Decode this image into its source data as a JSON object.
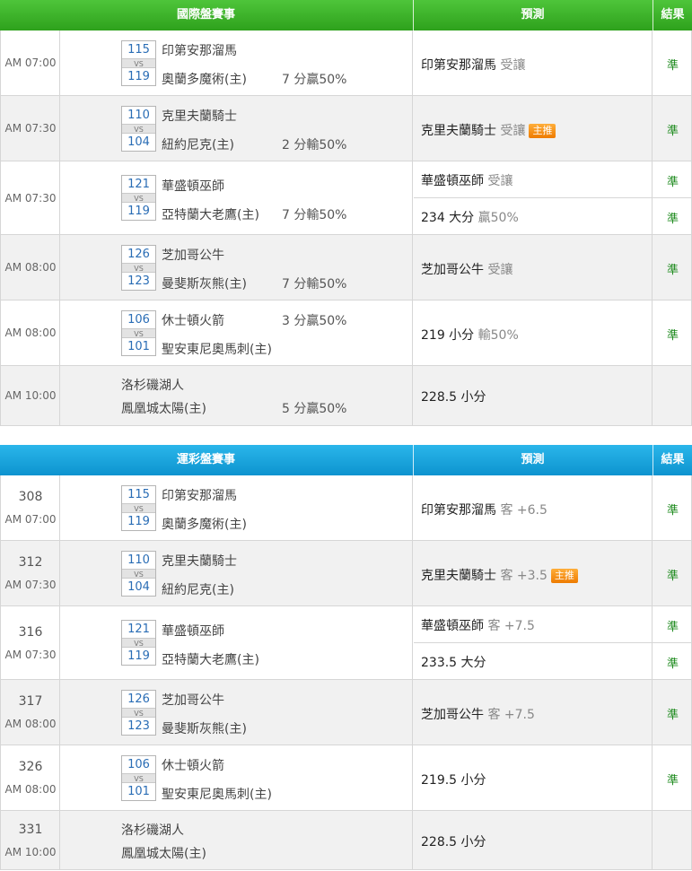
{
  "t1": {
    "header": {
      "game": "國際盤賽事",
      "pred": "預測",
      "result": "結果"
    },
    "r1": {
      "time": "AM 07:00",
      "rot_away": "115",
      "rot_home": "119",
      "vs": "VS",
      "away": "印第安那溜馬",
      "home": "奧蘭多魔術(主)",
      "hcp": "7 分贏50%",
      "pred_team": "印第安那溜馬",
      "pred_type": "受讓",
      "result": "準"
    },
    "r2": {
      "time": "AM 07:30",
      "rot_away": "110",
      "rot_home": "104",
      "vs": "VS",
      "away": "克里夫蘭騎士",
      "home": "紐約尼克(主)",
      "hcp": "2 分輸50%",
      "pred_team": "克里夫蘭騎士",
      "pred_type": "受讓",
      "badge": "主推",
      "result": "準"
    },
    "r3": {
      "time": "AM 07:30",
      "rot_away": "121",
      "rot_home": "119",
      "vs": "VS",
      "away": "華盛頓巫師",
      "home": "亞特蘭大老鷹(主)",
      "hcp": "7 分輸50%",
      "pred_team": "華盛頓巫師",
      "pred_type": "受讓",
      "result": "準",
      "pred2_main": "234 大分",
      "pred2_sub": "贏50%",
      "result2": "準"
    },
    "r4": {
      "time": "AM 08:00",
      "rot_away": "126",
      "rot_home": "123",
      "vs": "VS",
      "away": "芝加哥公牛",
      "home": "曼斐斯灰熊(主)",
      "hcp": "7 分輸50%",
      "pred_team": "芝加哥公牛",
      "pred_type": "受讓",
      "result": "準"
    },
    "r5": {
      "time": "AM 08:00",
      "rot_away": "106",
      "rot_home": "101",
      "vs": "VS",
      "away": "休士頓火箭",
      "home": "聖安東尼奧馬刺(主)",
      "hcp": "3 分贏50%",
      "pred_main": "219 小分",
      "pred_sub": "輸50%",
      "result": "準"
    },
    "r6": {
      "time": "AM 10:00",
      "away": "洛杉磯湖人",
      "home": "鳳凰城太陽(主)",
      "hcp": "5 分贏50%",
      "pred_main": "228.5 小分"
    }
  },
  "t2": {
    "header": {
      "game": "運彩盤賽事",
      "pred": "預測",
      "result": "結果"
    },
    "r1": {
      "num": "308",
      "time": "AM 07:00",
      "rot_away": "115",
      "rot_home": "119",
      "vs": "VS",
      "away": "印第安那溜馬",
      "home": "奧蘭多魔術(主)",
      "pred_team": "印第安那溜馬",
      "pred_type": "客 +6.5",
      "result": "準"
    },
    "r2": {
      "num": "312",
      "time": "AM 07:30",
      "rot_away": "110",
      "rot_home": "104",
      "vs": "VS",
      "away": "克里夫蘭騎士",
      "home": "紐約尼克(主)",
      "pred_team": "克里夫蘭騎士",
      "pred_type": "客 +3.5",
      "badge": "主推",
      "result": "準"
    },
    "r3": {
      "num": "316",
      "time": "AM 07:30",
      "rot_away": "121",
      "rot_home": "119",
      "vs": "VS",
      "away": "華盛頓巫師",
      "home": "亞特蘭大老鷹(主)",
      "pred_team": "華盛頓巫師",
      "pred_type": "客 +7.5",
      "result": "準",
      "pred2_main": "233.5 大分",
      "result2": "準"
    },
    "r4": {
      "num": "317",
      "time": "AM 08:00",
      "rot_away": "126",
      "rot_home": "123",
      "vs": "VS",
      "away": "芝加哥公牛",
      "home": "曼斐斯灰熊(主)",
      "pred_team": "芝加哥公牛",
      "pred_type": "客 +7.5",
      "result": "準"
    },
    "r5": {
      "num": "326",
      "time": "AM 08:00",
      "rot_away": "106",
      "rot_home": "101",
      "vs": "VS",
      "away": "休士頓火箭",
      "home": "聖安東尼奧馬刺(主)",
      "pred_main": "219.5 小分",
      "result": "準"
    },
    "r6": {
      "num": "331",
      "time": "AM 10:00",
      "away": "洛杉磯湖人",
      "home": "鳳凰城太陽(主)",
      "pred_main": "228.5 小分"
    }
  }
}
